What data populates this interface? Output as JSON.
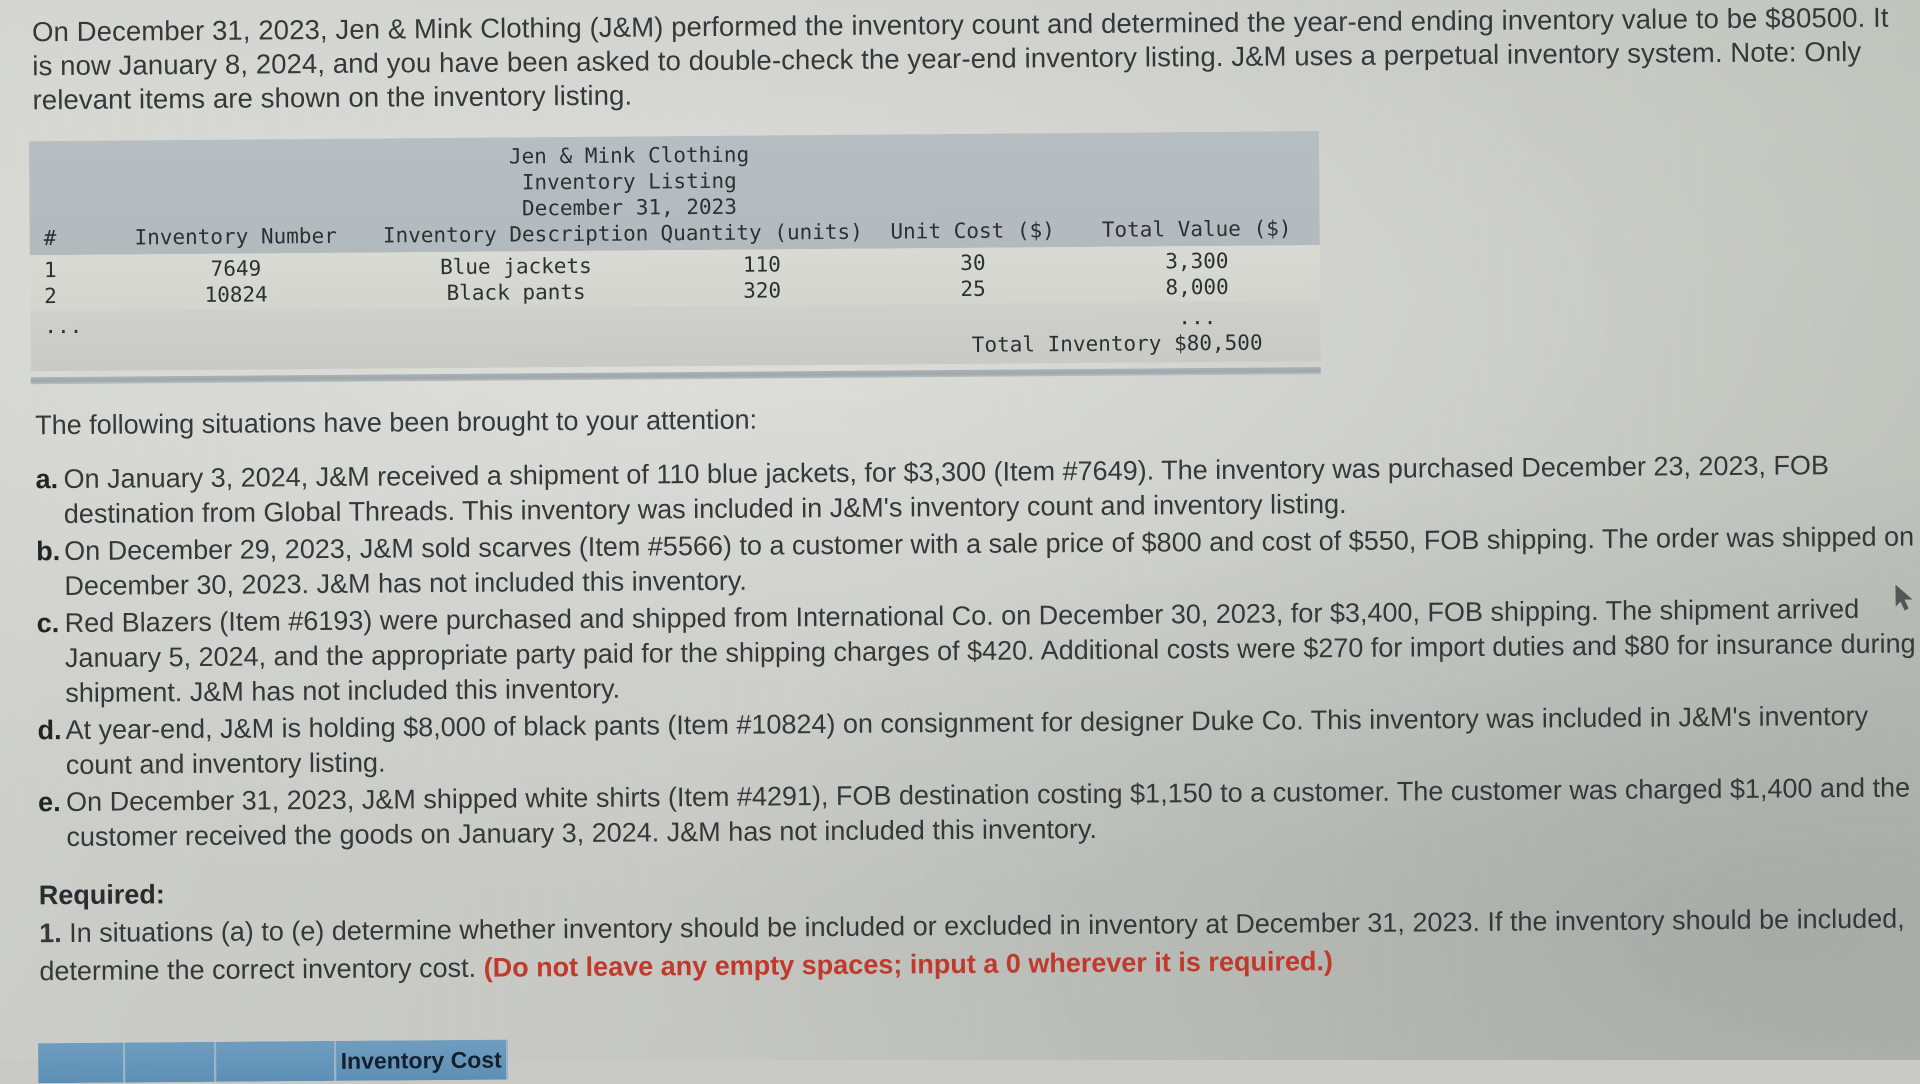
{
  "document": {
    "intro": "On December 31, 2023, Jen & Mink Clothing (J&M) performed the inventory count and determined the year-end ending inventory value to be $80500. It is now January 8, 2024, and you have been asked to double-check the year-end inventory listing. J&M uses a perpetual inventory system. Note: Only relevant items are shown on the inventory listing."
  },
  "listing": {
    "company": "Jen & Mink Clothing",
    "report_title": "Inventory Listing",
    "report_date": "December 31, 2023",
    "columns": {
      "num": "#",
      "inventory_number": "Inventory Number",
      "inventory_description": "Inventory Description",
      "quantity": "Quantity (units)",
      "unit_cost": "Unit Cost ($)",
      "total_value": "Total Value ($)"
    },
    "rows": [
      {
        "num": "1",
        "inventory_number": "7649",
        "description": "Blue jackets",
        "quantity": "110",
        "unit_cost": "30",
        "total_value": "3,300"
      },
      {
        "num": "2",
        "inventory_number": "10824",
        "description": "Black pants",
        "quantity": "320",
        "unit_cost": "25",
        "total_value": "8,000"
      }
    ],
    "ellipsis_left": "...",
    "ellipsis_right": "...",
    "total_label": "Total Inventory $80,500"
  },
  "situations": {
    "lead": "The following situations have been brought to your attention:",
    "items": [
      {
        "marker": "a.",
        "text": "On January 3, 2024, J&M received a shipment of 110 blue jackets, for $3,300 (Item #7649). The inventory was purchased December 23, 2023, FOB destination from Global Threads. This inventory was included in J&M's inventory count and inventory listing."
      },
      {
        "marker": "b.",
        "text": "On December 29, 2023, J&M sold scarves (Item #5566) to a customer with a sale price of $800 and cost of $550, FOB shipping. The order was shipped on December 30, 2023. J&M has not included this inventory."
      },
      {
        "marker": "c.",
        "text": "Red Blazers (Item #6193) were purchased and shipped from International Co. on December 30, 2023, for $3,400, FOB shipping. The shipment arrived January 5, 2024, and the appropriate party paid for the shipping charges of $420. Additional costs were $270 for import duties and $80 for insurance during shipment. J&M has not included this inventory."
      },
      {
        "marker": "d.",
        "text": "At year-end, J&M is holding $8,000 of black pants (Item #10824) on consignment for designer Duke Co. This inventory was included in J&M's inventory count and inventory listing."
      },
      {
        "marker": "e.",
        "text": "On December 31, 2023, J&M shipped white shirts (Item #4291), FOB destination costing $1,150 to a customer. The customer was charged $1,400 and the customer received the goods on January 3, 2024. J&M has not included this inventory."
      }
    ]
  },
  "required": {
    "title": "Required:",
    "number": "1.",
    "text_before_warning": "In situations (a) to (e) determine whether inventory should be included or excluded in inventory at December 31, 2023. If the inventory should be included, determine the correct inventory cost.",
    "warning": "(Do not leave any empty spaces; input a 0 wherever it is required.)"
  },
  "answer_table": {
    "header_color": "#5d8fb5",
    "columns": [
      "",
      "",
      "",
      "Inventory Cost"
    ]
  }
}
